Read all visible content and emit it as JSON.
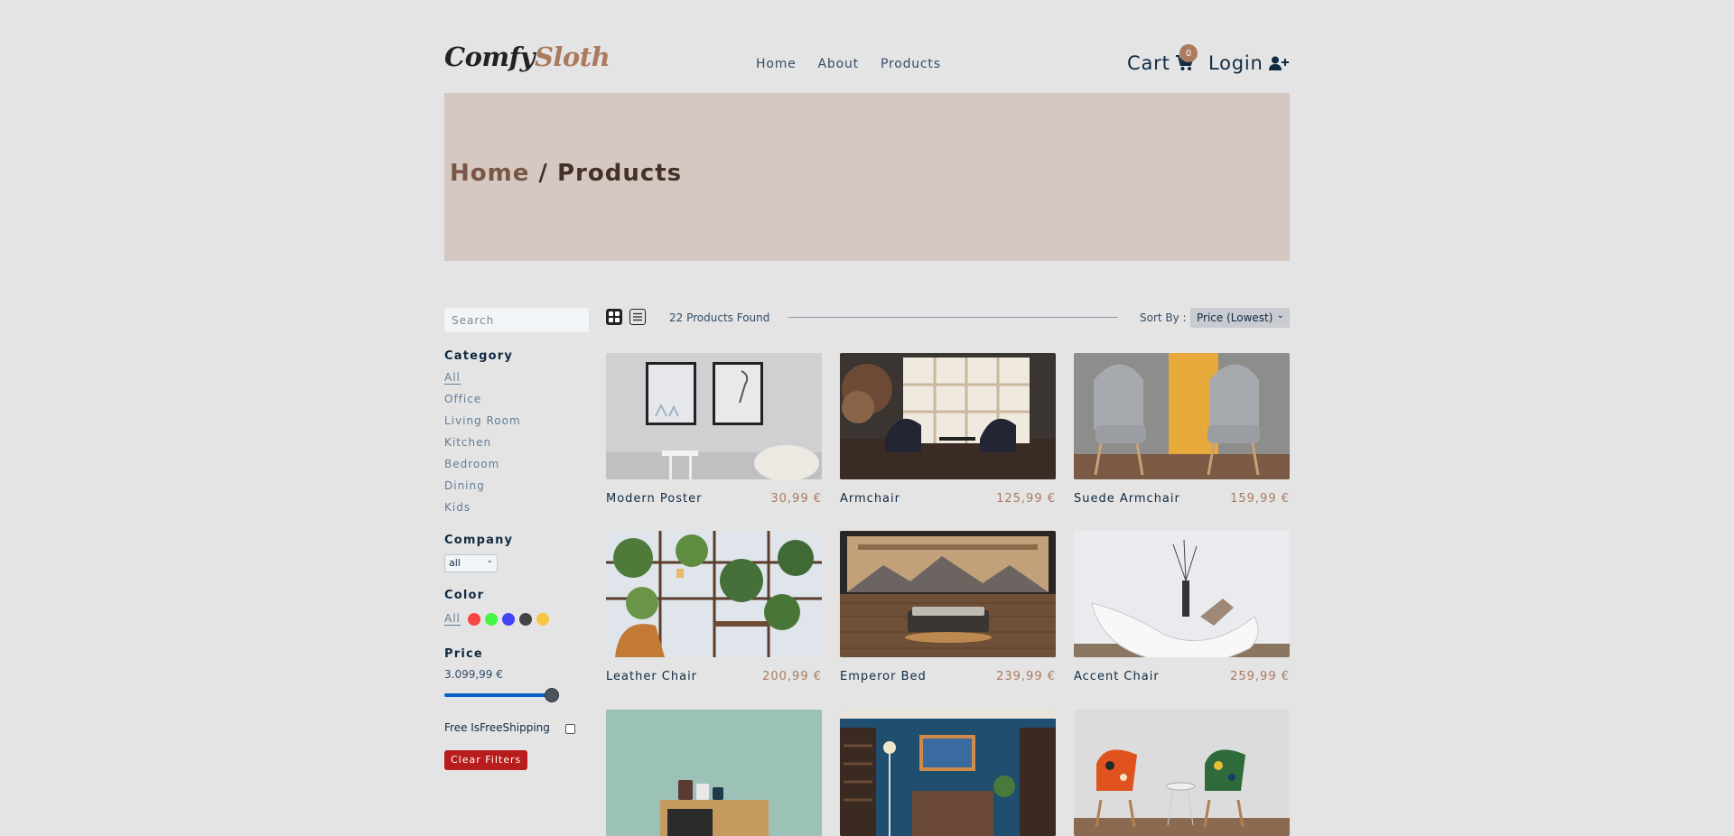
{
  "nav": {
    "logo_part1": "Comfy",
    "logo_part2": "Sloth",
    "links": [
      "Home",
      "About",
      "Products"
    ],
    "cart_label": "Cart",
    "cart_count": "0",
    "login_label": "Login"
  },
  "hero": {
    "crumb_home": "Home",
    "crumb_sep": " / ",
    "crumb_current": "Products"
  },
  "filters": {
    "search_placeholder": "Search",
    "category_title": "Category",
    "categories": [
      "All",
      "Office",
      "Living Room",
      "Kitchen",
      "Bedroom",
      "Dining",
      "Kids"
    ],
    "company_title": "Company",
    "company_value": "all",
    "color_title": "Color",
    "color_all": "All",
    "colors": [
      "#ff0000",
      "#00ff00",
      "#0000ff",
      "#000000",
      "#ffb900"
    ],
    "price_title": "Price",
    "price_value": "3.099,99 €",
    "price_fraction": 1.0,
    "shipping_label": "Free IsFreeShipping",
    "shipping_checked": false,
    "clear_label": "Clear Filters"
  },
  "products": {
    "found_text": "22 Products Found",
    "sort_label": "Sort By :",
    "sort_value": "Price (Lowest)",
    "items": [
      {
        "name": "Modern Poster",
        "price": "30,99 €"
      },
      {
        "name": "Armchair",
        "price": "125,99 €"
      },
      {
        "name": "Suede Armchair",
        "price": "159,99 €"
      },
      {
        "name": "Leather Chair",
        "price": "200,99 €"
      },
      {
        "name": "Emperor Bed",
        "price": "239,99 €"
      },
      {
        "name": "Accent Chair",
        "price": "259,99 €"
      },
      {
        "name": "",
        "price": ""
      },
      {
        "name": "",
        "price": ""
      },
      {
        "name": "",
        "price": ""
      }
    ]
  }
}
